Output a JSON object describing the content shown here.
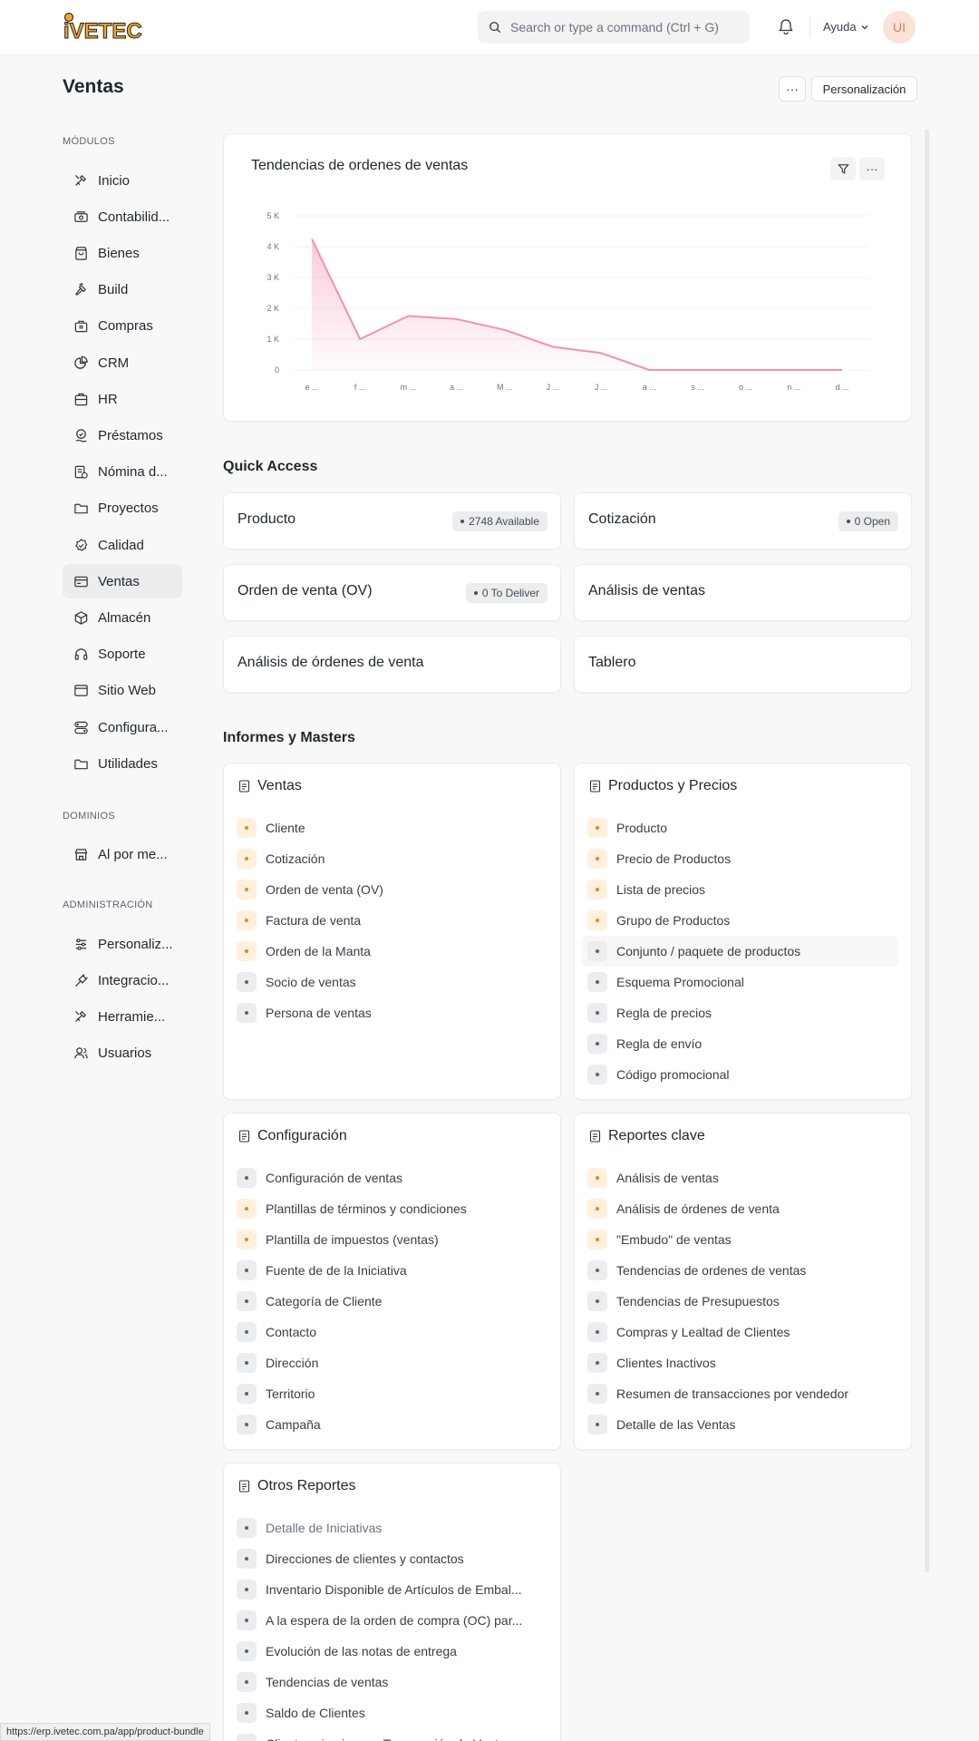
{
  "navbar": {
    "logo_text": "iVETEC",
    "search_placeholder": "Search or type a command (Ctrl + G)",
    "help_label": "Ayuda",
    "avatar_initials": "UI"
  },
  "page": {
    "title": "Ventas",
    "more_label": "···",
    "customize_label": "Personalización"
  },
  "sidebar": {
    "modules_heading": "MÓDULOS",
    "modules": [
      {
        "label": "Inicio",
        "icon": "tools-icon"
      },
      {
        "label": "Contabilid...",
        "icon": "money-icon"
      },
      {
        "label": "Bienes",
        "icon": "shopping-bag-icon"
      },
      {
        "label": "Build",
        "icon": "hammer-icon"
      },
      {
        "label": "Compras",
        "icon": "briefcase-icon"
      },
      {
        "label": "CRM",
        "icon": "chart-pie-icon"
      },
      {
        "label": "HR",
        "icon": "id-card-icon"
      },
      {
        "label": "Préstamos",
        "icon": "hand-coin-icon"
      },
      {
        "label": "Nómina d...",
        "icon": "payroll-icon"
      },
      {
        "label": "Proyectos",
        "icon": "folder-icon"
      },
      {
        "label": "Calidad",
        "icon": "badge-check-icon"
      },
      {
        "label": "Ventas",
        "icon": "sales-card-icon"
      },
      {
        "label": "Almacén",
        "icon": "box-icon"
      },
      {
        "label": "Soporte",
        "icon": "headset-icon"
      },
      {
        "label": "Sitio Web",
        "icon": "browser-icon"
      },
      {
        "label": "Configura...",
        "icon": "toggles-icon"
      },
      {
        "label": "Utilidades",
        "icon": "folder-icon"
      }
    ],
    "domains_heading": "DOMINIOS",
    "domains": [
      {
        "label": "Al por me...",
        "icon": "store-icon"
      }
    ],
    "admin_heading": "ADMINISTRACIÓN",
    "admin": [
      {
        "label": "Personaliz...",
        "icon": "sliders-icon"
      },
      {
        "label": "Integracio...",
        "icon": "plug-icon"
      },
      {
        "label": "Herramie...",
        "icon": "tools-icon"
      },
      {
        "label": "Usuarios",
        "icon": "users-icon"
      }
    ]
  },
  "chart_card": {
    "title": "Tendencias de ordenes de ventas",
    "filter_icon": "filter-icon",
    "more_label": "···"
  },
  "chart_data": {
    "type": "area",
    "title": "Tendencias de ordenes de ventas",
    "categories": [
      "e ...",
      "f ...",
      "m ...",
      "a ...",
      "M ...",
      "J ...",
      "J ...",
      "a ...",
      "s ...",
      "o ...",
      "n ...",
      "d ..."
    ],
    "values": [
      4250,
      1000,
      1750,
      1650,
      1300,
      750,
      550,
      0,
      0,
      0,
      0,
      0
    ],
    "y_ticks": [
      "0",
      "1 K",
      "2 K",
      "3 K",
      "4 K",
      "5 K"
    ],
    "ylim": [
      0,
      5000
    ],
    "color": "#f48fb1",
    "grid": true
  },
  "quick_access": {
    "heading": "Quick Access",
    "items": [
      {
        "label": "Producto",
        "badge": "2748 Available"
      },
      {
        "label": "Cotización",
        "badge": "0 Open"
      },
      {
        "label": "Orden de venta (OV)",
        "badge": "0 To Deliver"
      },
      {
        "label": "Análisis de ventas",
        "badge": ""
      },
      {
        "label": "Análisis de órdenes de venta",
        "badge": ""
      },
      {
        "label": "Tablero",
        "badge": ""
      }
    ]
  },
  "reports": {
    "heading": "Informes y Masters",
    "cards": [
      {
        "title": "Ventas",
        "items": [
          {
            "label": "Cliente",
            "warn": true
          },
          {
            "label": "Cotización",
            "warn": true
          },
          {
            "label": "Orden de venta (OV)",
            "warn": true
          },
          {
            "label": "Factura de venta",
            "warn": true
          },
          {
            "label": "Orden de la Manta",
            "warn": true
          },
          {
            "label": "Socio de ventas",
            "warn": false
          },
          {
            "label": "Persona de ventas",
            "warn": false
          }
        ]
      },
      {
        "title": "Productos y Precios",
        "items": [
          {
            "label": "Producto",
            "warn": true
          },
          {
            "label": "Precio de Productos",
            "warn": true
          },
          {
            "label": "Lista de precios",
            "warn": true
          },
          {
            "label": "Grupo de Productos",
            "warn": true
          },
          {
            "label": "Conjunto / paquete de productos",
            "warn": false,
            "hl": true
          },
          {
            "label": "Esquema Promocional",
            "warn": false
          },
          {
            "label": "Regla de precios",
            "warn": false
          },
          {
            "label": "Regla de envío",
            "warn": false
          },
          {
            "label": "Código promocional",
            "warn": false
          }
        ]
      },
      {
        "title": "Configuración",
        "items": [
          {
            "label": "Configuración de ventas",
            "warn": false
          },
          {
            "label": "Plantillas de términos y condiciones",
            "warn": true
          },
          {
            "label": "Plantilla de impuestos (ventas)",
            "warn": true
          },
          {
            "label": "Fuente de de la Iniciativa",
            "warn": false
          },
          {
            "label": "Categoría de Cliente",
            "warn": false
          },
          {
            "label": "Contacto",
            "warn": false
          },
          {
            "label": "Dirección",
            "warn": false
          },
          {
            "label": "Territorio",
            "warn": false
          },
          {
            "label": "Campaña",
            "warn": false
          }
        ]
      },
      {
        "title": "Reportes clave",
        "items": [
          {
            "label": "Análisis de ventas",
            "warn": true
          },
          {
            "label": "Análisis de órdenes de venta",
            "warn": true
          },
          {
            "label": "\"Embudo\" de ventas",
            "warn": true
          },
          {
            "label": "Tendencias de ordenes de ventas",
            "warn": false
          },
          {
            "label": "Tendencias de Presupuestos",
            "warn": false
          },
          {
            "label": "Compras y Lealtad de Clientes",
            "warn": false
          },
          {
            "label": "Clientes Inactivos",
            "warn": false
          },
          {
            "label": "Resumen de transacciones por vendedor",
            "warn": false
          },
          {
            "label": "Detalle de las Ventas",
            "warn": false
          }
        ]
      },
      {
        "title": "Otros Reportes",
        "items": [
          {
            "label": "Detalle de Iniciativas",
            "warn": false,
            "muted": true
          },
          {
            "label": "Direcciones de clientes y contactos",
            "warn": false
          },
          {
            "label": "Inventario Disponible de Artículos de Embal...",
            "warn": false
          },
          {
            "label": "A la espera de la orden de compra (OC) par...",
            "warn": false
          },
          {
            "label": "Evolución de las notas de entrega",
            "warn": false
          },
          {
            "label": "Tendencias de ventas",
            "warn": false
          },
          {
            "label": "Saldo de Clientes",
            "warn": false
          },
          {
            "label": "Clientes sin ninguna Transacción de Ventas",
            "warn": false
          }
        ]
      }
    ]
  },
  "status_bar": {
    "url": "https://erp.ivetec.com.pa/app/product-bundle"
  }
}
